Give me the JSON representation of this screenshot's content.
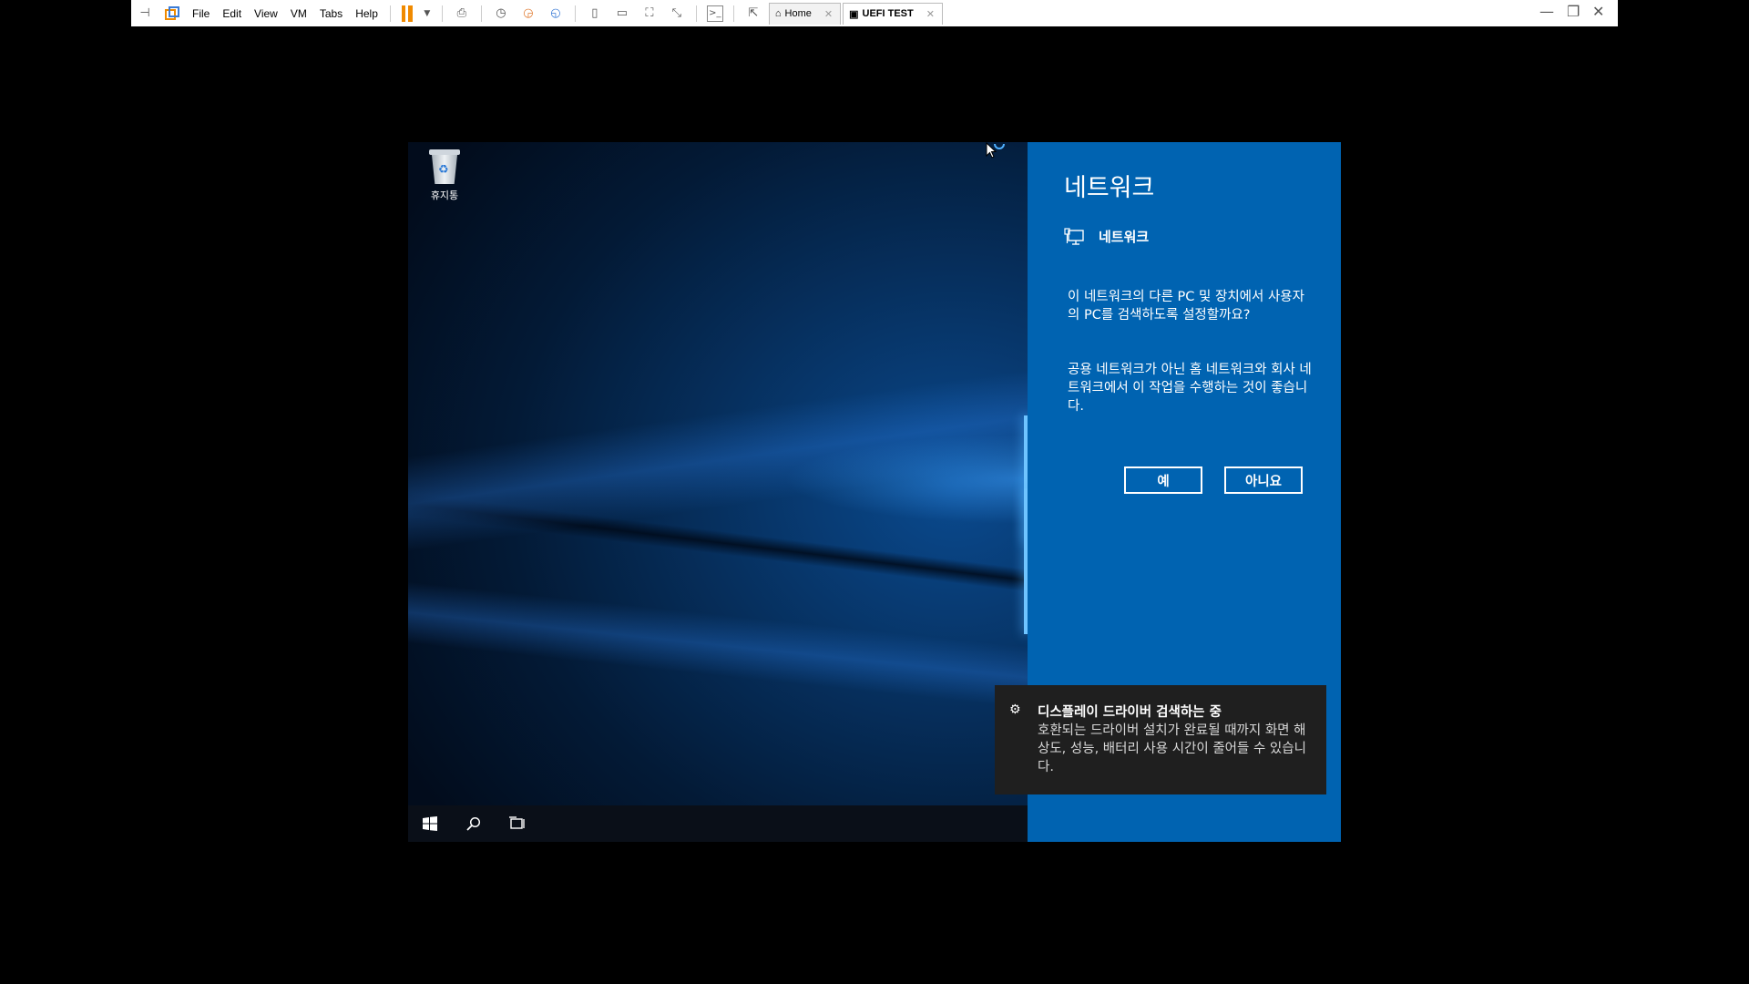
{
  "toolbar": {
    "menu": [
      "File",
      "Edit",
      "View",
      "VM",
      "Tabs",
      "Help"
    ],
    "tabs": [
      {
        "label": "Home",
        "active": false
      },
      {
        "label": "UEFI TEST",
        "active": true
      }
    ],
    "pause_color": "#f08a00"
  },
  "desktop": {
    "recycle_bin_label": "휴지통"
  },
  "network_panel": {
    "background": "#0063b1",
    "title": "네트워크",
    "subtitle": "네트워크",
    "question": "이 네트워크의 다른 PC 및 장치에서 사용자의 PC를 검색하도록 설정할까요?",
    "advice": "공용 네트워크가 아닌 홈 네트워크와 회사 네트워크에서 이 작업을 수행하는 것이 좋습니다.",
    "yes_label": "예",
    "no_label": "아니요"
  },
  "toast": {
    "title": "디스플레이 드라이버 검색하는 중",
    "body": "호환되는 드라이버 설치가 완료될 때까지 화면 해상도, 성능, 배터리 사용 시간이 줄어들 수 있습니다."
  }
}
